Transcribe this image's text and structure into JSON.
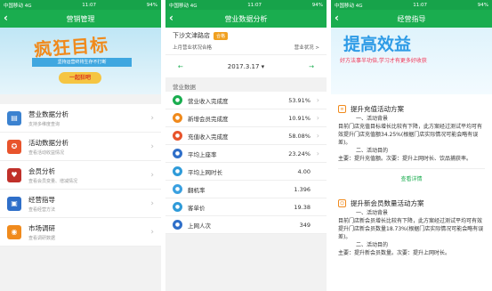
{
  "status": {
    "carrier": "中国移动 4G",
    "time": "11:07",
    "battery": "94%"
  },
  "phone1": {
    "title": "营销管理",
    "banner": {
      "headline": "疯狂目标",
      "ribbon": "坚持运营终将生存不打断",
      "button": "一起狂吧"
    },
    "menu": [
      {
        "title": "营业数据分析",
        "subtitle": "支持多维度查询",
        "icon": "bar-chart-icon",
        "color": "#3b82d0"
      },
      {
        "title": "活动数据分析",
        "subtitle": "查看活动收益情况",
        "icon": "activity-icon",
        "color": "#e8542c"
      },
      {
        "title": "会员分析",
        "subtitle": "查看会员变量、增减情况",
        "icon": "member-icon",
        "color": "#c0302a"
      },
      {
        "title": "经营指导",
        "subtitle": "查看经营方法",
        "icon": "book-icon",
        "color": "#2f6fc9"
      },
      {
        "title": "市场调研",
        "subtitle": "查看调研数据",
        "icon": "location-icon",
        "color": "#f08a1c"
      }
    ]
  },
  "phone2": {
    "title": "营业数据分析",
    "store": "下沙文津路店",
    "store_tag": "合格",
    "last_month": "上月营业状况合格",
    "status_link": "营业状况 >",
    "date": "2017.3.17",
    "section": "营业数据",
    "rows": [
      {
        "label": "营业收入完成度",
        "value": "53.91%",
        "color": "#1aad4f",
        "arrow": true
      },
      {
        "label": "新增会员完成度",
        "value": "10.91%",
        "color": "#f08a1c",
        "arrow": true
      },
      {
        "label": "充值收入完成度",
        "value": "58.08%",
        "color": "#e8542c",
        "arrow": true
      },
      {
        "label": "平均上座率",
        "value": "23.24%",
        "color": "#2f6fc9",
        "arrow": true
      },
      {
        "label": "平均上网时长",
        "value": "4.00",
        "color": "#2f9bd9",
        "arrow": false
      },
      {
        "label": "翻机率",
        "value": "1.396",
        "color": "#3aa0e0",
        "arrow": false
      },
      {
        "label": "客单价",
        "value": "19.38",
        "color": "#2f9bd9",
        "arrow": false
      },
      {
        "label": "上网人次",
        "value": "349",
        "color": "#2f6fc9",
        "arrow": false
      }
    ]
  },
  "phone3": {
    "title": "经营指导",
    "banner": {
      "headline": "提高效益",
      "sub": "好方法事半功倍,学习才有更多好收获"
    },
    "plan1": {
      "title": "提升充值活动方案",
      "lines": [
        "一、活动背景",
        "目前门店充值目标增长比较有下降，此方案经过测试平均可有效提升门店充值额34.25%(根据门店实际情况可能会略有误差)。",
        "二、活动目的",
        "主要：提升充值额。次要：提升上网时长、饮品捕获率。"
      ],
      "more": "查看详情"
    },
    "plan2": {
      "title": "提升新会员数量活动方案",
      "lines": [
        "一、活动背景",
        "目前门店新会员增长比较有下降，此方案经过测试平均可有效提升门店新会员数量18.73%(根据门店实际情况可能会略有误差)。",
        "二、活动目的",
        "主要：提升新会员数量。次要：提升上网时长。"
      ]
    }
  }
}
